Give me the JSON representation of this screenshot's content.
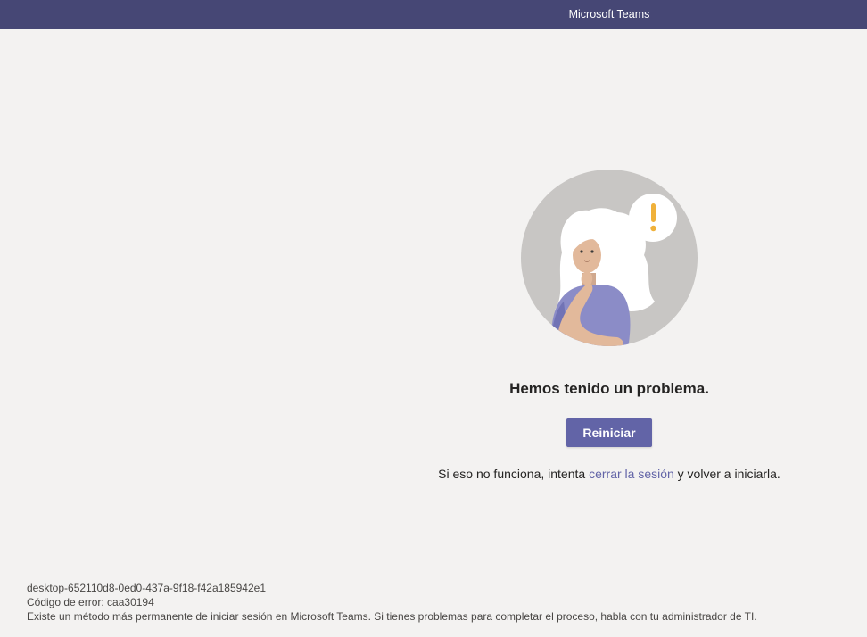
{
  "window": {
    "title": "Microsoft Teams"
  },
  "error": {
    "heading": "Hemos tenido un problema.",
    "restart_label": "Reiniciar",
    "hint_before": "Si eso no funciona, intenta ",
    "hint_link": "cerrar la sesión",
    "hint_after": " y volver a iniciarla."
  },
  "footer": {
    "device_id": "desktop-652110d8-0ed0-437a-9f18-f42a185942e1",
    "error_code": "Código de error: caa30194",
    "info": "Existe un método más permanente de iniciar sesión en Microsoft Teams. Si tienes problemas para completar el proceso, habla con tu administrador de TI."
  },
  "colors": {
    "titlebar": "#464775",
    "accent": "#6264a7",
    "background": "#f3f2f1"
  },
  "icons": {
    "illustration": "confused-person-illustration",
    "alert": "exclamation-icon"
  }
}
